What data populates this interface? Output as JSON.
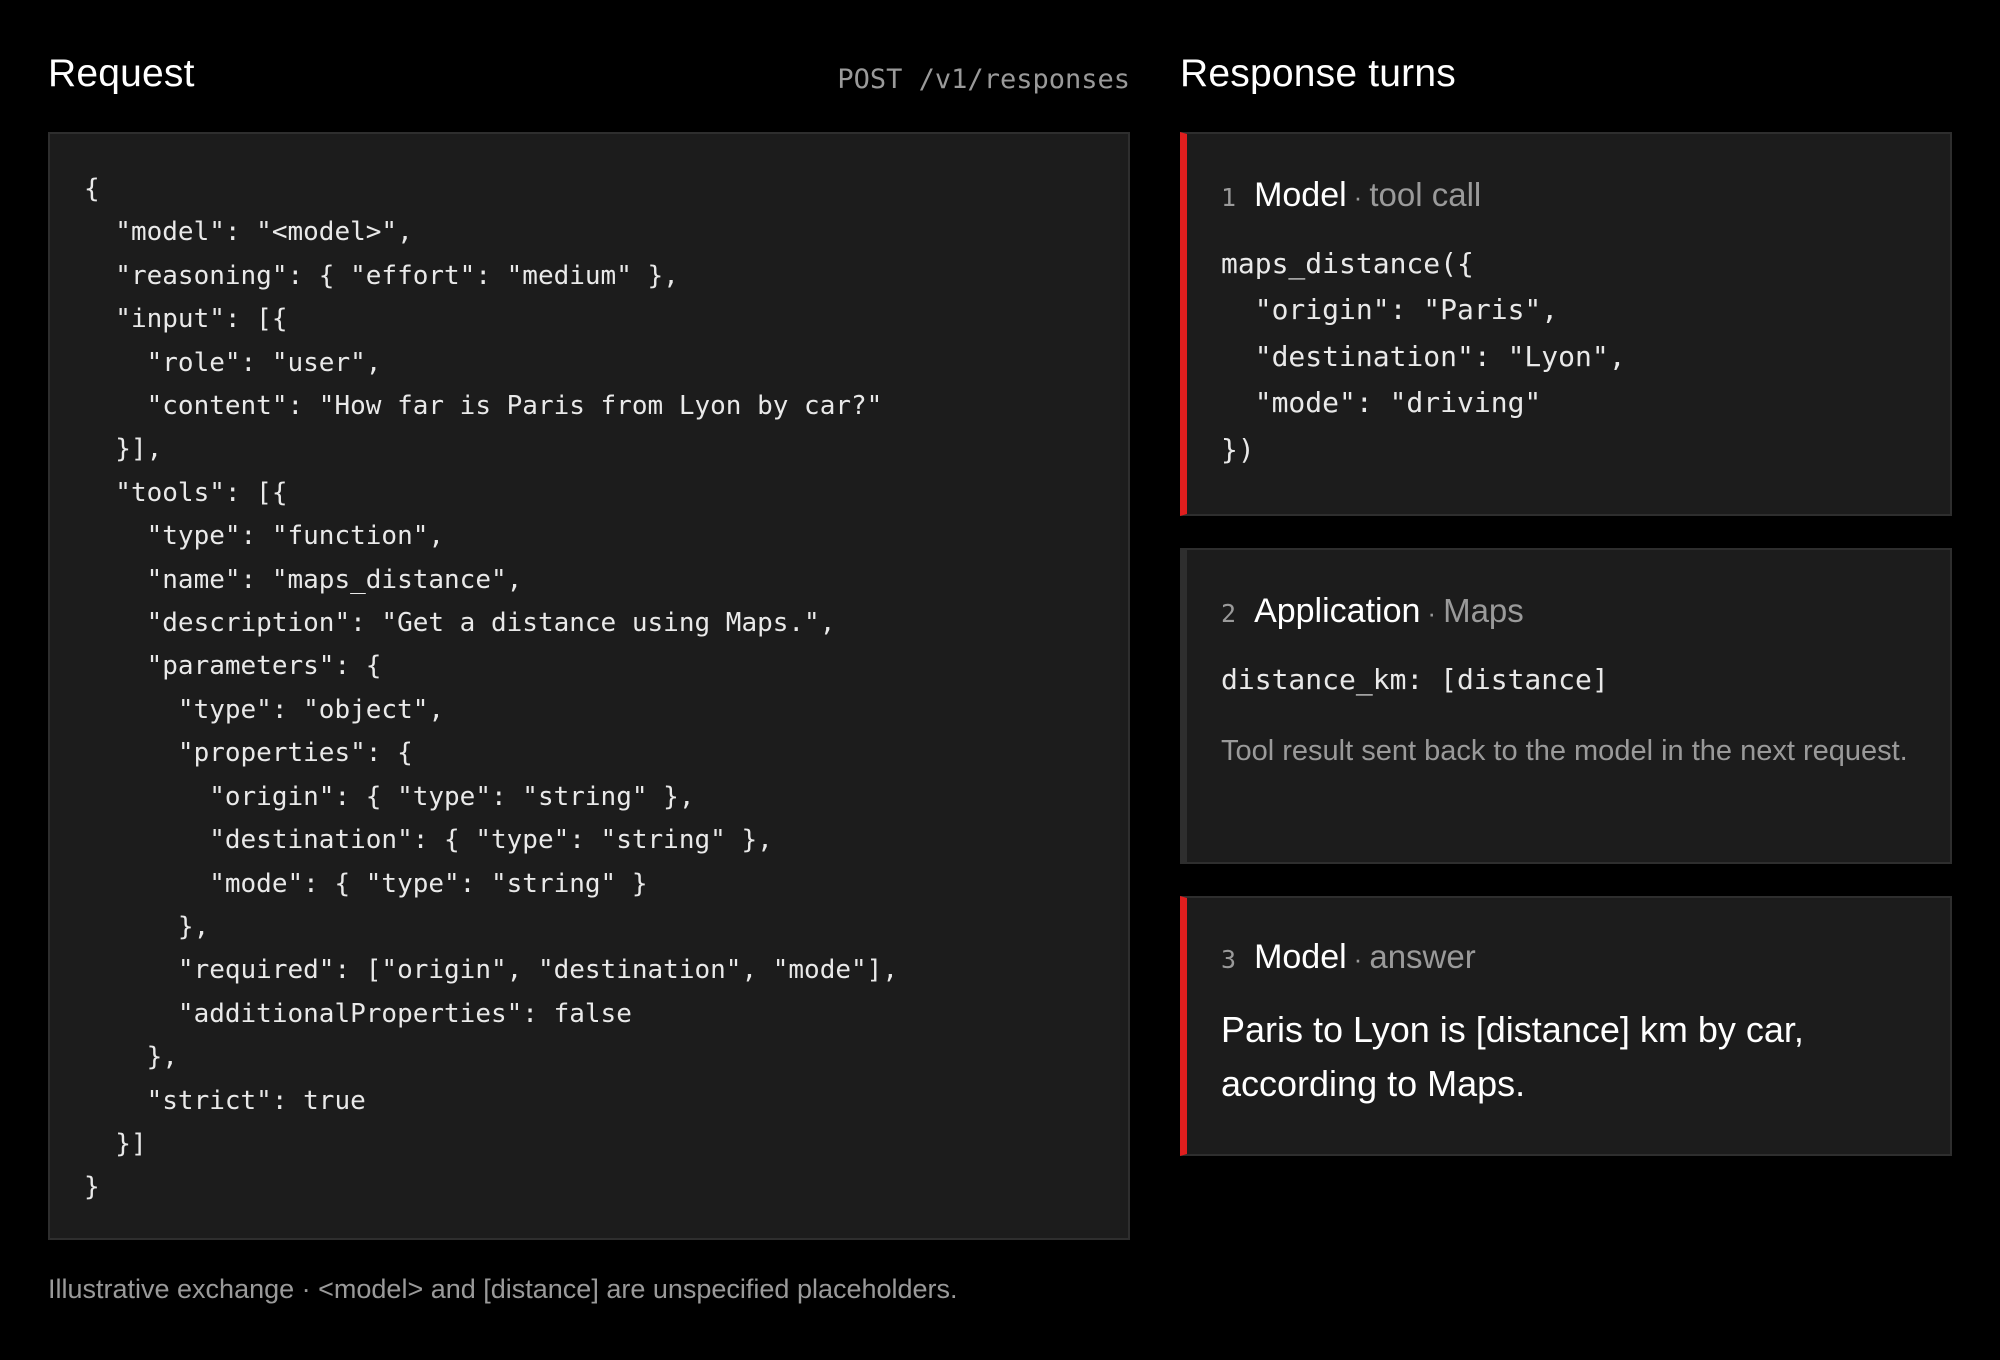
{
  "request": {
    "heading": "Request",
    "endpoint": "POST /v1/responses",
    "body": "{\n  \"model\": \"<model>\",\n  \"reasoning\": { \"effort\": \"medium\" },\n  \"input\": [{\n    \"role\": \"user\",\n    \"content\": \"How far is Paris from Lyon by car?\"\n  }],\n  \"tools\": [{\n    \"type\": \"function\",\n    \"name\": \"maps_distance\",\n    \"description\": \"Get a distance using Maps.\",\n    \"parameters\": {\n      \"type\": \"object\",\n      \"properties\": {\n        \"origin\": { \"type\": \"string\" },\n        \"destination\": { \"type\": \"string\" },\n        \"mode\": { \"type\": \"string\" }\n      },\n      \"required\": [\"origin\", \"destination\", \"mode\"],\n      \"additionalProperties\": false\n    },\n    \"strict\": true\n  }]\n}"
  },
  "response": {
    "heading": "Response turns",
    "separator": "·",
    "turns": [
      {
        "number": "1",
        "actor": "Model",
        "kind": "tool call",
        "code": "maps_distance({\n  \"origin\": \"Paris\",\n  \"destination\": \"Lyon\",\n  \"mode\": \"driving\"\n})"
      },
      {
        "number": "2",
        "actor": "Application",
        "kind": "Maps",
        "code": "distance_km: [distance]",
        "note": "Tool result sent back to the model in the next request."
      },
      {
        "number": "3",
        "actor": "Model",
        "kind": "answer",
        "text": "Paris to Lyon is [distance] km by car, according to Maps."
      }
    ]
  },
  "footnote": "Illustrative exchange · <model> and [distance] are unspecified placeholders.",
  "colors": {
    "background": "#000000",
    "panel": "#1c1c1c",
    "panel_border": "#2e2e2e",
    "accent": "#e01e1e",
    "muted_text": "#9a9a9a"
  }
}
